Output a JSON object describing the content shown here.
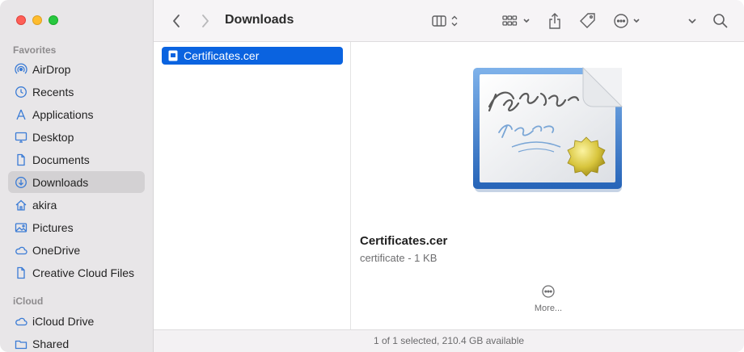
{
  "window": {
    "title": "Downloads"
  },
  "sidebar": {
    "favorites_label": "Favorites",
    "icloud_label": "iCloud",
    "favorites": [
      {
        "label": "AirDrop",
        "icon": "airdrop-icon"
      },
      {
        "label": "Recents",
        "icon": "clock-icon"
      },
      {
        "label": "Applications",
        "icon": "applications-icon"
      },
      {
        "label": "Desktop",
        "icon": "desktop-icon"
      },
      {
        "label": "Documents",
        "icon": "document-icon"
      },
      {
        "label": "Downloads",
        "icon": "download-icon",
        "selected": true
      },
      {
        "label": "akira",
        "icon": "home-icon"
      },
      {
        "label": "Pictures",
        "icon": "pictures-icon"
      },
      {
        "label": "OneDrive",
        "icon": "cloud-icon"
      },
      {
        "label": "Creative Cloud Files",
        "icon": "file-icon"
      }
    ],
    "icloud": [
      {
        "label": "iCloud Drive",
        "icon": "icloud-icon"
      },
      {
        "label": "Shared",
        "icon": "shared-folder-icon"
      }
    ]
  },
  "files": [
    {
      "name": "Certificates.cer",
      "selected": true
    }
  ],
  "preview": {
    "name": "Certificates.cer",
    "kind": "certificate - 1 KB",
    "more_label": "More..."
  },
  "status": {
    "text": "1 of 1 selected, 210.4 GB available"
  },
  "colors": {
    "accent": "#0a63e0",
    "sidebar_bg": "#e8e6e8",
    "sidebar_selected": "#d3d1d3"
  }
}
